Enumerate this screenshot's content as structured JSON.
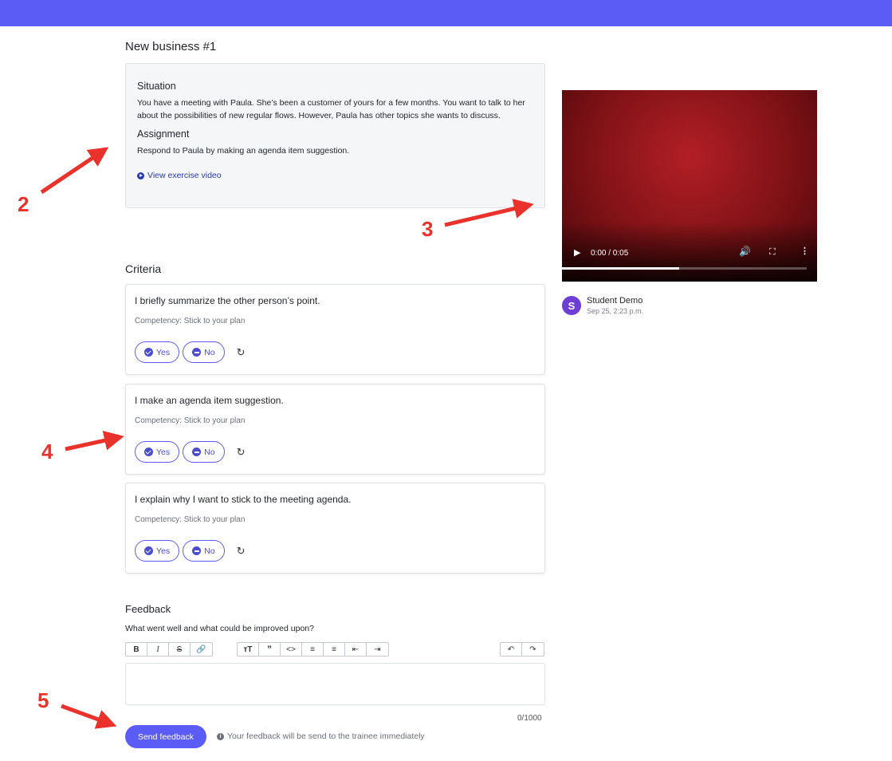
{
  "exercise": {
    "title": "New business #1",
    "situation_heading": "Situation",
    "situation_text": "You have a meeting with Paula. She’s been a customer of yours for a few months. You want to talk to her about the possibilities of new regular flows. However, Paula has other topics she wants to discuss.",
    "assignment_heading": "Assignment",
    "assignment_text": "Respond to Paula by making an agenda item suggestion.",
    "video_link": "View exercise video"
  },
  "video": {
    "time": "0:00 / 0:05",
    "progress_fraction": 0.48,
    "colors": {
      "background": "#8b1418"
    }
  },
  "submission": {
    "avatar_letter": "S",
    "author": "Student Demo",
    "date": "Sep 25, 2:23 p.m."
  },
  "criteria": {
    "title": "Criteria",
    "yes_label": "Yes",
    "no_label": "No",
    "items": [
      {
        "text": "I briefly summarize the other person’s point.",
        "competency": "Competency: Stick to your plan"
      },
      {
        "text": "I make an agenda item suggestion.",
        "competency": "Competency: Stick to your plan"
      },
      {
        "text": "I explain why I want to stick to the meeting agenda.",
        "competency": "Competency: Stick to your plan"
      }
    ]
  },
  "feedback": {
    "title": "Feedback",
    "prompt": "What went well and what could be improved upon?",
    "value": "",
    "counter": "0/1000",
    "send_label": "Send feedback",
    "notice": "Your feedback will be send to the trainee immediately",
    "toolbar_icons": [
      "bold-icon",
      "italic-icon",
      "strikethrough-icon",
      "link-icon",
      "heading-icon",
      "quote-icon",
      "code-icon",
      "bullet-list-icon",
      "numbered-list-icon",
      "outdent-icon",
      "indent-icon",
      "undo-icon",
      "redo-icon"
    ]
  },
  "annotations": [
    "2",
    "3",
    "4",
    "5"
  ],
  "colors": {
    "accent": "#5b5cf6",
    "annotation": "#e8322b"
  }
}
